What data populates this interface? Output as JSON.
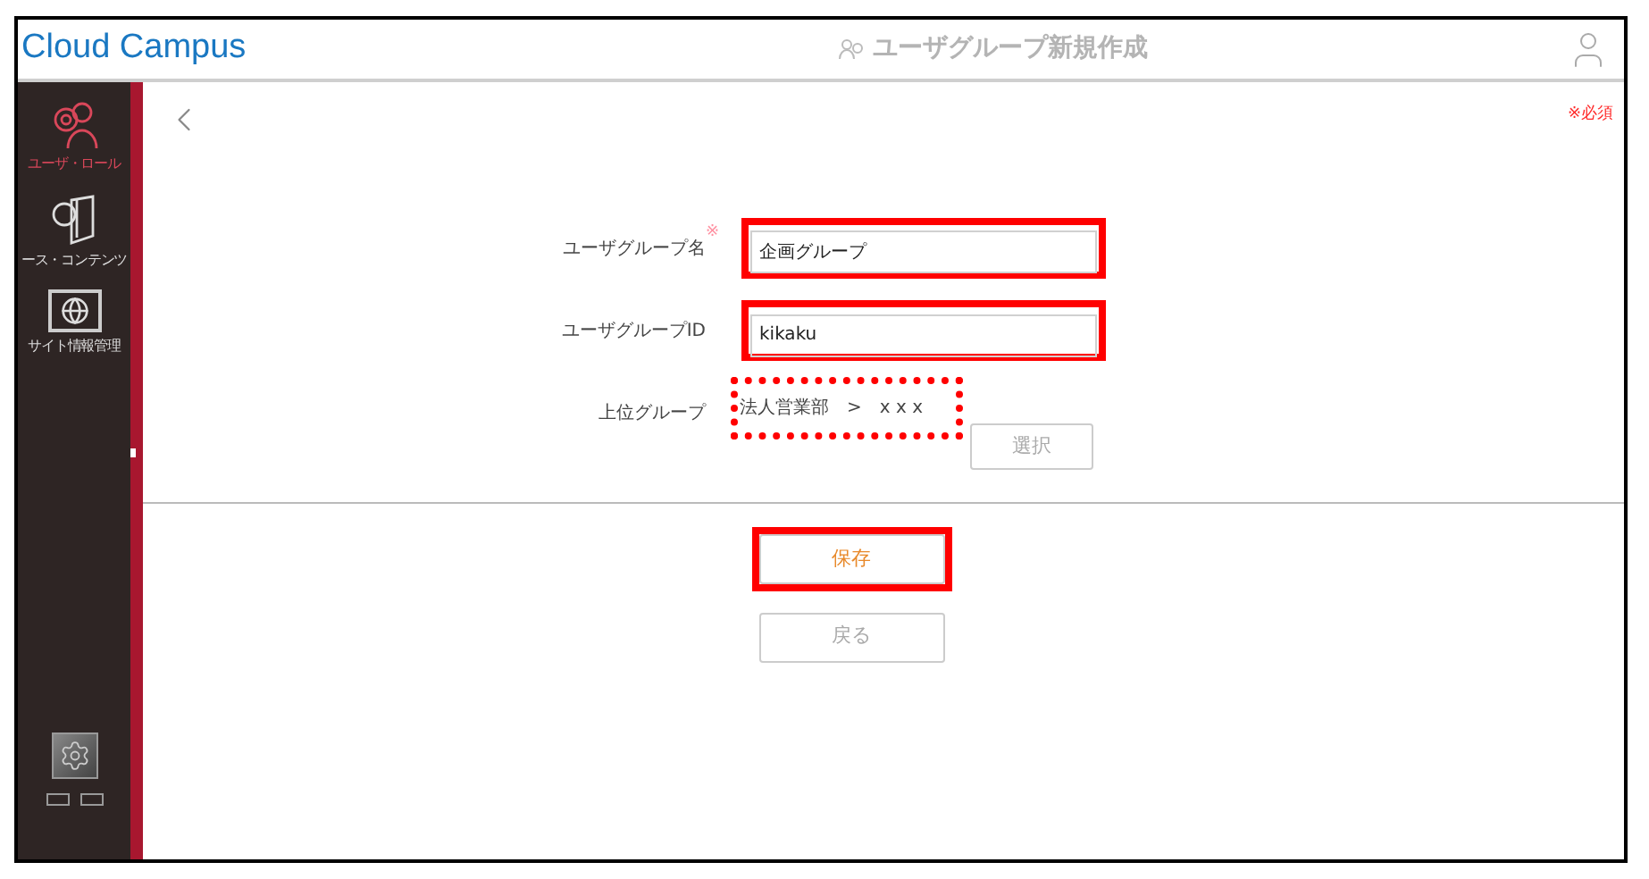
{
  "header": {
    "logo": "Cloud Campus",
    "title": "ユーザグループ新規作成"
  },
  "sidebar": {
    "items": [
      {
        "label": "ユーザ・ロール",
        "selected": true,
        "kind": "users"
      },
      {
        "label": "ース・コンテンツ",
        "selected": false,
        "kind": "contents"
      },
      {
        "label": "サイト情報管理",
        "selected": false,
        "kind": "site"
      }
    ]
  },
  "required_note": "※必須",
  "form": {
    "fields": [
      {
        "kind": "input",
        "label": "ユーザグループ名",
        "required": true,
        "required_mark": "※",
        "value": "企画グループ",
        "highlighted": true,
        "dotted": false
      },
      {
        "kind": "input",
        "label": "ユーザグループID",
        "required": false,
        "value": "kikaku",
        "highlighted": true,
        "dotted": false
      },
      {
        "kind": "picker",
        "label": "上位グループ",
        "required": false,
        "value": "法人営業部　>　x x x",
        "highlighted": true,
        "dotted": true,
        "button": "選択"
      }
    ]
  },
  "buttons": [
    {
      "label": "保存",
      "kind": "primary",
      "highlighted": true
    },
    {
      "label": "戻る",
      "kind": "secondary",
      "highlighted": false
    }
  ]
}
